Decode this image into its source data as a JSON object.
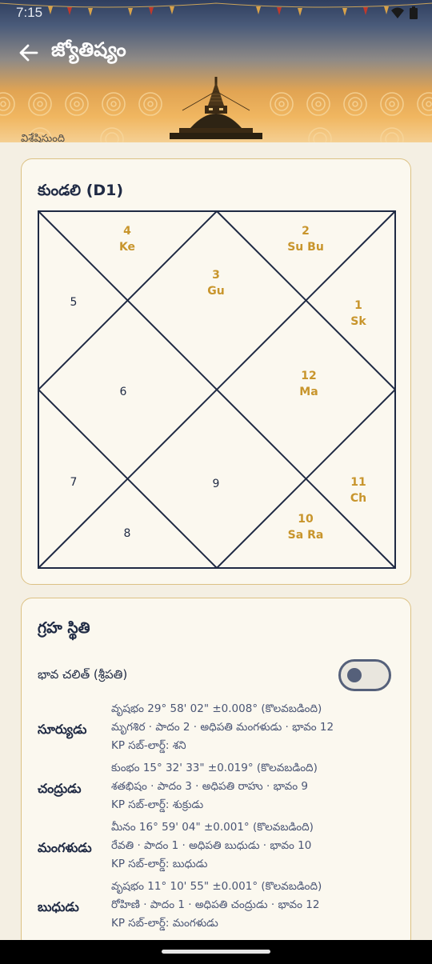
{
  "status_bar": {
    "time": "7:15"
  },
  "header": {
    "title": "జ్యోతిష్యం",
    "subtext": "విశ్లేషిస్తుంది"
  },
  "kundali_card": {
    "title": "కుండలి (D1)",
    "houses": [
      {
        "num": "1",
        "planets": "Sk"
      },
      {
        "num": "2",
        "planets": "Su Bu"
      },
      {
        "num": "3",
        "planets": "Gu"
      },
      {
        "num": "4",
        "planets": "Ke"
      },
      {
        "num": "5",
        "planets": ""
      },
      {
        "num": "6",
        "planets": ""
      },
      {
        "num": "7",
        "planets": ""
      },
      {
        "num": "8",
        "planets": ""
      },
      {
        "num": "9",
        "planets": ""
      },
      {
        "num": "10",
        "planets": "Sa Ra"
      },
      {
        "num": "11",
        "planets": "Ch"
      },
      {
        "num": "12",
        "planets": "Ma"
      }
    ]
  },
  "positions_card": {
    "title": "గ్రహ స్థితి",
    "toggle_label": "భావ చలిత్ (శ్రీపతి)",
    "toggle_on": false,
    "planets": [
      {
        "name": "సూర్యుడు",
        "line1": "వృషభం 29° 58' 02\"  ±0.008° (కొలవబడింది)",
        "line2": "మృగశిర · పాదం 2 · అధిపతి మంగళుడు · భావం 12",
        "line3": "KP సబ్-లార్డ్: శని"
      },
      {
        "name": "చంద్రుడు",
        "line1": "కుంభం 15° 32' 33\"  ±0.019° (కొలవబడింది)",
        "line2": "శతభిషం · పాదం 3 · అధిపతి రాహు · భావం 9",
        "line3": "KP సబ్-లార్డ్: శుక్రుడు"
      },
      {
        "name": "మంగళుడు",
        "line1": "మీనం 16° 59' 04\"  ±0.001° (కొలవబడింది)",
        "line2": "రేవతి · పాదం 1 · అధిపతి బుధుడు · భావం 10",
        "line3": "KP సబ్-లార్డ్: బుధుడు"
      },
      {
        "name": "బుధుడు",
        "line1": "వృషభం 11° 10' 55\"  ±0.001° (కొలవబడింది)",
        "line2": "రోహిణి · పాదం 1 · అధిపతి చంద్రుడు · భావం 12",
        "line3": "KP సబ్-లార్డ్: మంగళుడు"
      }
    ]
  },
  "colors": {
    "occupied": "#c8952c",
    "empty": "#1f2a44",
    "line": "#1f2a44",
    "border": "#dcc184"
  }
}
